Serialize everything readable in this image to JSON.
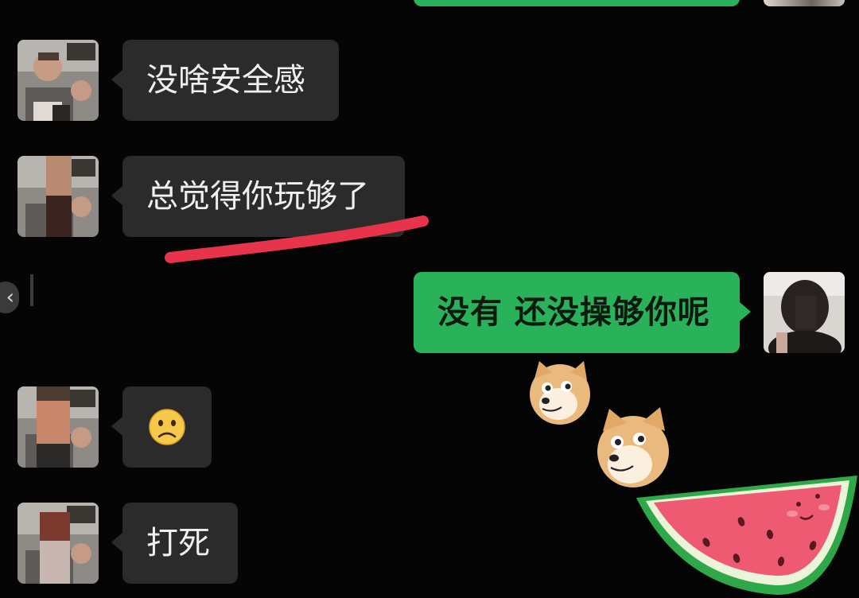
{
  "chat": {
    "messages": [
      {
        "sender": "other",
        "text": "没啥安全感"
      },
      {
        "sender": "other",
        "text": "总觉得你玩够了"
      },
      {
        "sender": "me",
        "text": "没有 还没操够你呢"
      },
      {
        "sender": "other",
        "emoji": "☹"
      },
      {
        "sender": "other",
        "text": "打死"
      }
    ]
  },
  "colors": {
    "background": "#050505",
    "incoming_bubble": "#2b2b2b",
    "outgoing_bubble": "#29b25a",
    "highlight_underline": "#e8344a"
  },
  "icons": {
    "back": "‹"
  }
}
